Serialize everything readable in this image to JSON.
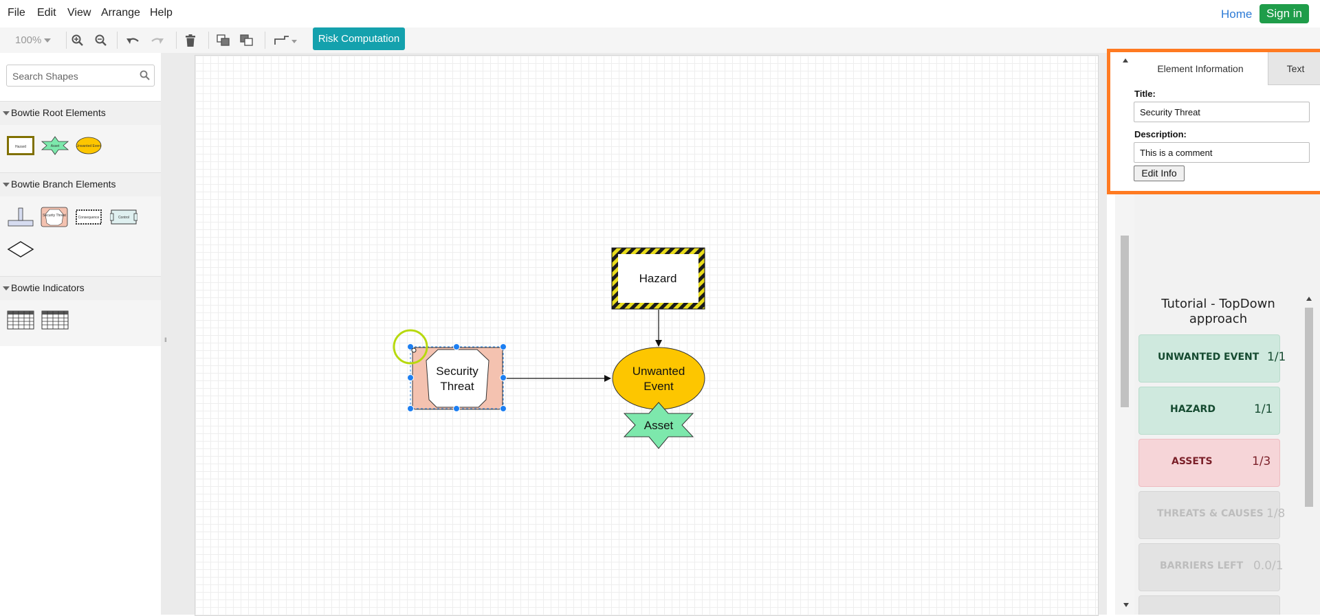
{
  "menu": {
    "file": "File",
    "edit": "Edit",
    "view": "View",
    "arrange": "Arrange",
    "help": "Help"
  },
  "topnav": {
    "home": "Home",
    "sign_in": "Sign in"
  },
  "toolbar": {
    "zoom": "100%",
    "risk_computation": "Risk Computation"
  },
  "sidebar": {
    "search_placeholder": "Search Shapes",
    "sections": [
      {
        "label": "Bowtie Root Elements"
      },
      {
        "label": "Bowtie Branch Elements"
      },
      {
        "label": "Bowtie Indicators"
      }
    ],
    "root_shapes": {
      "hazard": "Hazard",
      "asset": "Asset",
      "unwanted_event": "Unwanted Event"
    },
    "branch_shapes": {
      "threat": "Security Threat",
      "consequence": "Consequence",
      "control": "Control"
    }
  },
  "diagram": {
    "hazard": "Hazard",
    "unwanted_event_line1": "Unwanted",
    "unwanted_event_line2": "Event",
    "asset": "Asset",
    "threat_line1": "Security",
    "threat_line2": "Threat"
  },
  "element_info": {
    "tab_info": "Element Information",
    "tab_text": "Text",
    "title_label": "Title:",
    "title_value": "Security Threat",
    "description_label": "Description:",
    "description_value": "This is a comment",
    "edit_button": "Edit Info"
  },
  "tutorial": {
    "title": "Tutorial - TopDown approach",
    "items": [
      {
        "name": "UNWANTED EVENT",
        "count": "1/1"
      },
      {
        "name": "HAZARD",
        "count": "1/1"
      },
      {
        "name": "ASSETS",
        "count": "1/3"
      },
      {
        "name": "THREATS & CAUSES",
        "count": "1/8"
      },
      {
        "name": "BARRIERS LEFT",
        "count": "0.0/1"
      }
    ]
  },
  "colors": {
    "accent_orange": "#ff7a21",
    "risk_button": "#14a1ad",
    "sign_in": "#1f9d4a",
    "hazard_stripe": "#e8dc1c",
    "unwanted_event_fill": "#fdc600",
    "asset_fill": "#7de8ac",
    "threat_fill": "#f4c2b0"
  }
}
